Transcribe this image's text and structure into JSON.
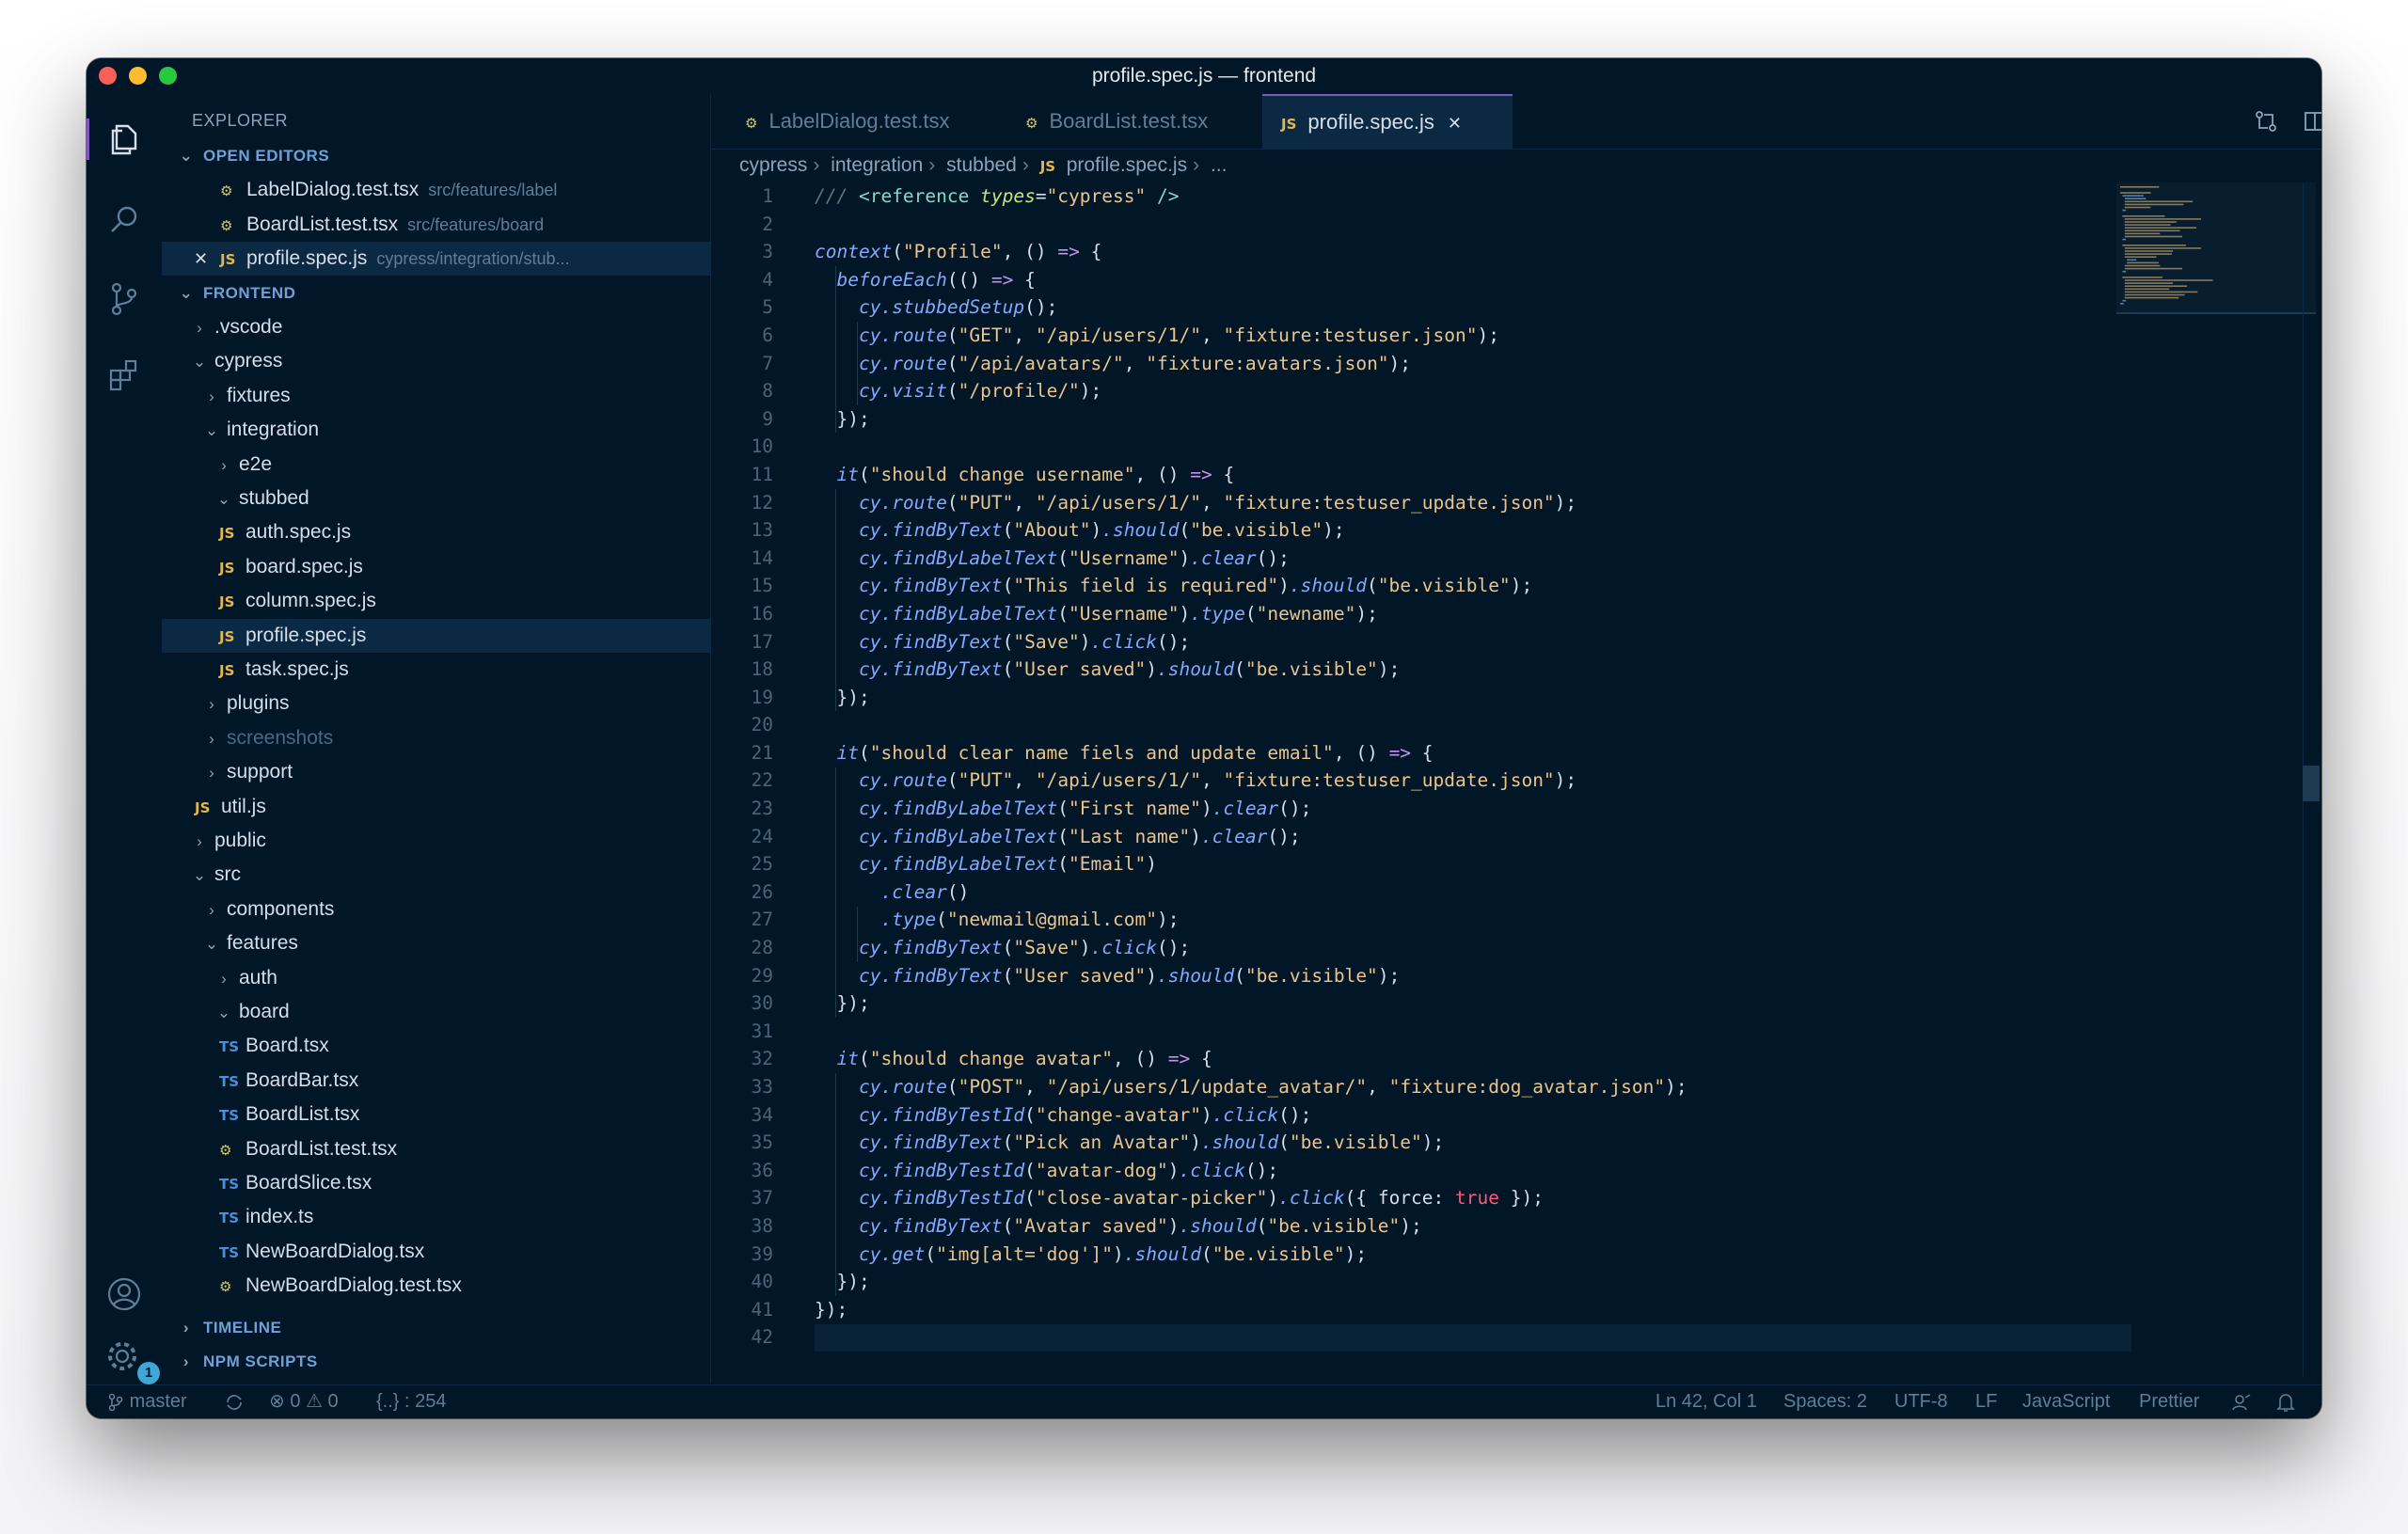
{
  "window": {
    "title": "profile.spec.js — frontend"
  },
  "activity_bar": {
    "icons": [
      "files-icon",
      "search-icon",
      "source-control-icon",
      "extensions-icon",
      "account-icon",
      "settings-gear-icon"
    ],
    "settings_badge": "1"
  },
  "sidebar": {
    "title": "EXPLORER",
    "open_editors": {
      "header": "OPEN EDITORS",
      "items": [
        {
          "name": "LabelDialog.test.tsx",
          "path": "src/features/label",
          "icon": "test"
        },
        {
          "name": "BoardList.test.tsx",
          "path": "src/features/board",
          "icon": "test"
        },
        {
          "name": "profile.spec.js",
          "path": "cypress/integration/stub...",
          "icon": "js"
        }
      ]
    },
    "folder_header": "FRONTEND",
    "tree": [
      {
        "name": ".vscode",
        "kind": "folder",
        "open": false,
        "depth": 0
      },
      {
        "name": "cypress",
        "kind": "folder",
        "open": true,
        "depth": 0
      },
      {
        "name": "fixtures",
        "kind": "folder",
        "open": false,
        "depth": 1
      },
      {
        "name": "integration",
        "kind": "folder",
        "open": true,
        "depth": 1
      },
      {
        "name": "e2e",
        "kind": "folder",
        "open": false,
        "depth": 2
      },
      {
        "name": "stubbed",
        "kind": "folder",
        "open": true,
        "depth": 2
      },
      {
        "name": "auth.spec.js",
        "kind": "js",
        "depth": 3
      },
      {
        "name": "board.spec.js",
        "kind": "js",
        "depth": 3
      },
      {
        "name": "column.spec.js",
        "kind": "js",
        "depth": 3
      },
      {
        "name": "profile.spec.js",
        "kind": "js",
        "depth": 3,
        "selected": true
      },
      {
        "name": "task.spec.js",
        "kind": "js",
        "depth": 3
      },
      {
        "name": "plugins",
        "kind": "folder",
        "open": false,
        "depth": 1
      },
      {
        "name": "screenshots",
        "kind": "folder",
        "open": false,
        "depth": 1,
        "dim": true
      },
      {
        "name": "support",
        "kind": "folder",
        "open": false,
        "depth": 1
      },
      {
        "name": "util.js",
        "kind": "js",
        "depth": 1
      },
      {
        "name": "public",
        "kind": "folder",
        "open": false,
        "depth": 0
      },
      {
        "name": "src",
        "kind": "folder",
        "open": true,
        "depth": 0
      },
      {
        "name": "components",
        "kind": "folder",
        "open": false,
        "depth": 1
      },
      {
        "name": "features",
        "kind": "folder",
        "open": true,
        "depth": 1
      },
      {
        "name": "auth",
        "kind": "folder",
        "open": false,
        "depth": 2
      },
      {
        "name": "board",
        "kind": "folder",
        "open": true,
        "depth": 2
      },
      {
        "name": "Board.tsx",
        "kind": "ts",
        "depth": 3
      },
      {
        "name": "BoardBar.tsx",
        "kind": "ts",
        "depth": 3
      },
      {
        "name": "BoardList.tsx",
        "kind": "ts",
        "depth": 3
      },
      {
        "name": "BoardList.test.tsx",
        "kind": "test",
        "depth": 3
      },
      {
        "name": "BoardSlice.tsx",
        "kind": "ts",
        "depth": 3
      },
      {
        "name": "index.ts",
        "kind": "ts",
        "depth": 3
      },
      {
        "name": "NewBoardDialog.tsx",
        "kind": "ts",
        "depth": 3
      },
      {
        "name": "NewBoardDialog.test.tsx",
        "kind": "test",
        "depth": 3
      }
    ],
    "timeline_header": "TIMELINE",
    "npm_header": "NPM SCRIPTS"
  },
  "tabs": [
    {
      "label": "LabelDialog.test.tsx",
      "icon": "test",
      "active": false
    },
    {
      "label": "BoardList.test.tsx",
      "icon": "test",
      "active": false
    },
    {
      "label": "profile.spec.js",
      "icon": "js",
      "active": true,
      "close": "✕"
    }
  ],
  "file_icon_labels": {
    "js": "JS",
    "ts": "TS"
  },
  "breadcrumb": [
    "cypress",
    "integration",
    "stubbed",
    "profile.spec.js",
    "..."
  ],
  "code_lines": [
    "/// <reference types=\"cypress\" />",
    "",
    "context(\"Profile\", () => {",
    "  beforeEach(() => {",
    "    cy.stubbedSetup();",
    "    cy.route(\"GET\", \"/api/users/1/\", \"fixture:testuser.json\");",
    "    cy.route(\"/api/avatars/\", \"fixture:avatars.json\");",
    "    cy.visit(\"/profile/\");",
    "  });",
    "",
    "  it(\"should change username\", () => {",
    "    cy.route(\"PUT\", \"/api/users/1/\", \"fixture:testuser_update.json\");",
    "    cy.findByText(\"About\").should(\"be.visible\");",
    "    cy.findByLabelText(\"Username\").clear();",
    "    cy.findByText(\"This field is required\").should(\"be.visible\");",
    "    cy.findByLabelText(\"Username\").type(\"newname\");",
    "    cy.findByText(\"Save\").click();",
    "    cy.findByText(\"User saved\").should(\"be.visible\");",
    "  });",
    "",
    "  it(\"should clear name fiels and update email\", () => {",
    "    cy.route(\"PUT\", \"/api/users/1/\", \"fixture:testuser_update.json\");",
    "    cy.findByLabelText(\"First name\").clear();",
    "    cy.findByLabelText(\"Last name\").clear();",
    "    cy.findByLabelText(\"Email\")",
    "      .clear()",
    "      .type(\"newmail@gmail.com\");",
    "    cy.findByText(\"Save\").click();",
    "    cy.findByText(\"User saved\").should(\"be.visible\");",
    "  });",
    "",
    "  it(\"should change avatar\", () => {",
    "    cy.route(\"POST\", \"/api/users/1/update_avatar/\", \"fixture:dog_avatar.json\");",
    "    cy.findByTestId(\"change-avatar\").click();",
    "    cy.findByText(\"Pick an Avatar\").should(\"be.visible\");",
    "    cy.findByTestId(\"avatar-dog\").click();",
    "    cy.findByTestId(\"close-avatar-picker\").click({ force: true });",
    "    cy.findByText(\"Avatar saved\").should(\"be.visible\");",
    "    cy.get(\"img[alt='dog']\").should(\"be.visible\");",
    "  });",
    "});",
    ""
  ],
  "status_bar": {
    "branch": "master",
    "errors": "0",
    "warnings": "0",
    "symbols": "{..} : 254",
    "position": "Ln 42, Col 1",
    "spaces": "Spaces: 2",
    "encoding": "UTF-8",
    "eol": "LF",
    "language": "JavaScript",
    "formatter": "Prettier"
  },
  "colors": {
    "background": "#011627",
    "accent": "#7e57c2",
    "selection": "#0b2942",
    "string": "#ecc48d",
    "function": "#82aaff",
    "arrow": "#c792ea",
    "boolean": "#ff5874"
  }
}
